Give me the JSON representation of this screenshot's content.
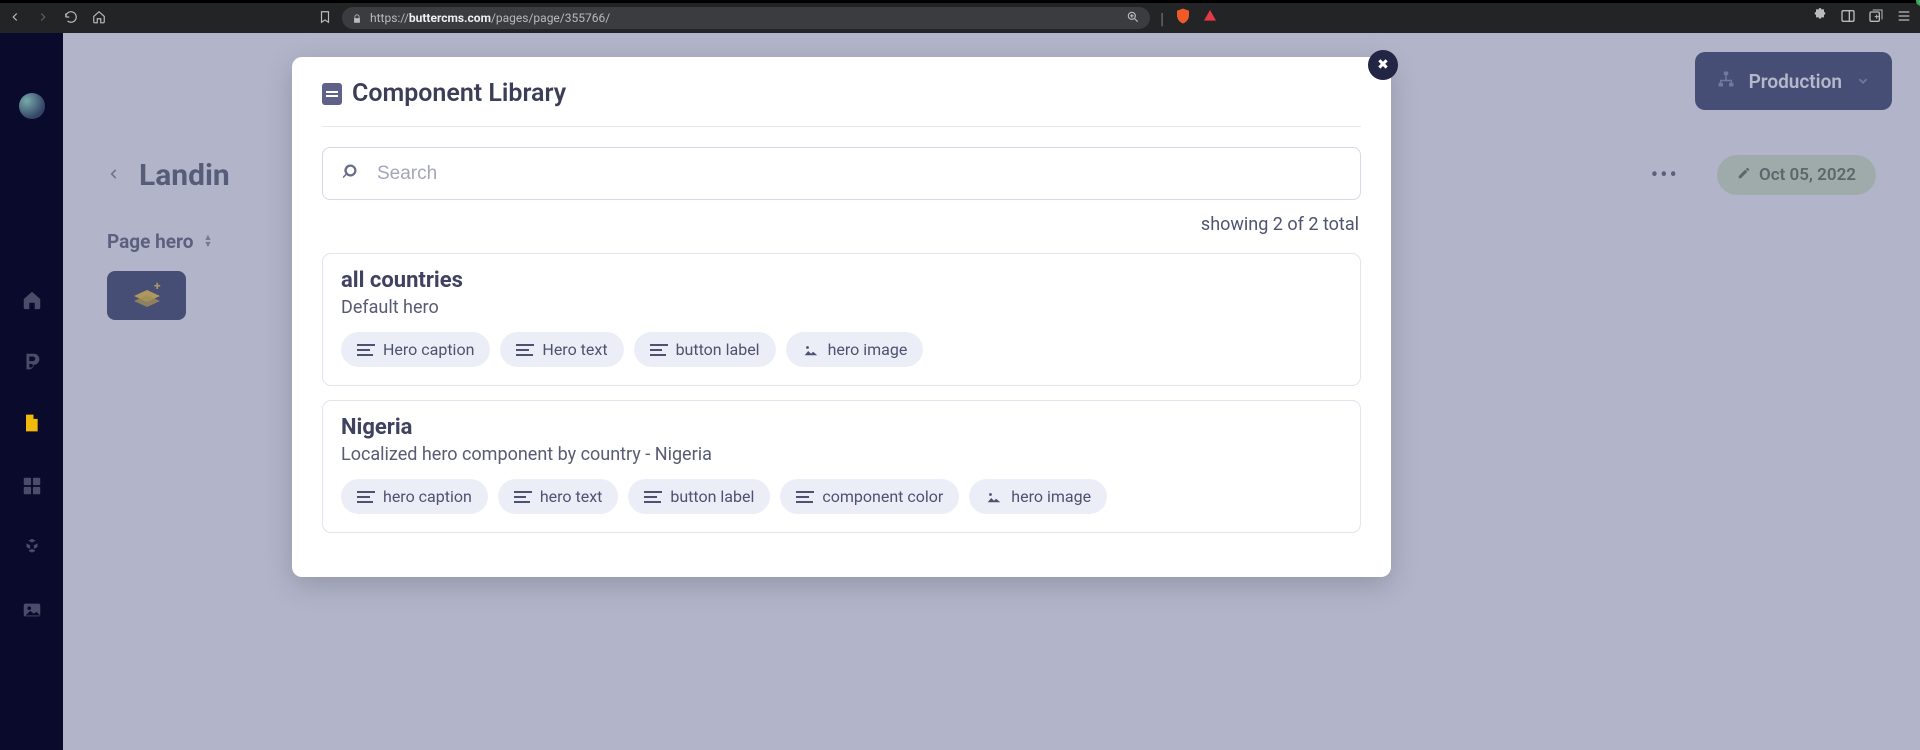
{
  "browser": {
    "url_prefix": "https://",
    "url_host": "buttercms.com",
    "url_path": "/pages/page/355766/",
    "shield_count": "5"
  },
  "app": {
    "environment_label": "Production",
    "page_title": "Landin",
    "date_label": "Oct 05, 2022",
    "section_label": "Page hero"
  },
  "modal": {
    "title": "Component Library",
    "search_placeholder": "Search",
    "results_text": "showing 2 of 2 total",
    "components": [
      {
        "name": "all countries",
        "description": "Default hero",
        "fields": [
          {
            "label": "Hero caption",
            "kind": "text"
          },
          {
            "label": "Hero text",
            "kind": "text"
          },
          {
            "label": "button label",
            "kind": "text"
          },
          {
            "label": "hero image",
            "kind": "image"
          }
        ]
      },
      {
        "name": "Nigeria",
        "description": "Localized hero component by country - Nigeria",
        "fields": [
          {
            "label": "hero caption",
            "kind": "text"
          },
          {
            "label": "hero text",
            "kind": "text"
          },
          {
            "label": "button label",
            "kind": "text"
          },
          {
            "label": "component color",
            "kind": "text"
          },
          {
            "label": "hero image",
            "kind": "image"
          }
        ]
      }
    ]
  }
}
